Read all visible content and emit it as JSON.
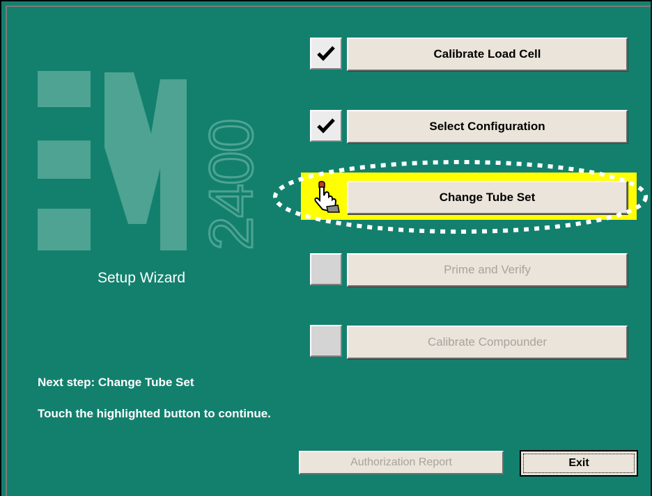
{
  "logo": {
    "model_number": "2400"
  },
  "wizard": {
    "title": "Setup Wizard"
  },
  "steps": [
    {
      "label": "Calibrate Load Cell",
      "state": "completed",
      "icon": "check-icon"
    },
    {
      "label": "Select Configuration",
      "state": "completed",
      "icon": "check-icon"
    },
    {
      "label": "Change Tube Set",
      "state": "current",
      "icon": "pointing-hand-icon"
    },
    {
      "label": "Prime and Verify",
      "state": "disabled",
      "icon": ""
    },
    {
      "label": "Calibrate Compounder",
      "state": "disabled",
      "icon": ""
    }
  ],
  "status": {
    "next_step": "Next step: Change Tube Set",
    "instruction": "Touch the highlighted button to continue."
  },
  "footer": {
    "authorization_report_label": "Authorization Report",
    "exit_label": "Exit"
  },
  "colors": {
    "background": "#13806e",
    "highlight": "#ffff00",
    "button_face": "#eae4da",
    "disabled_text": "#a7a49e"
  }
}
